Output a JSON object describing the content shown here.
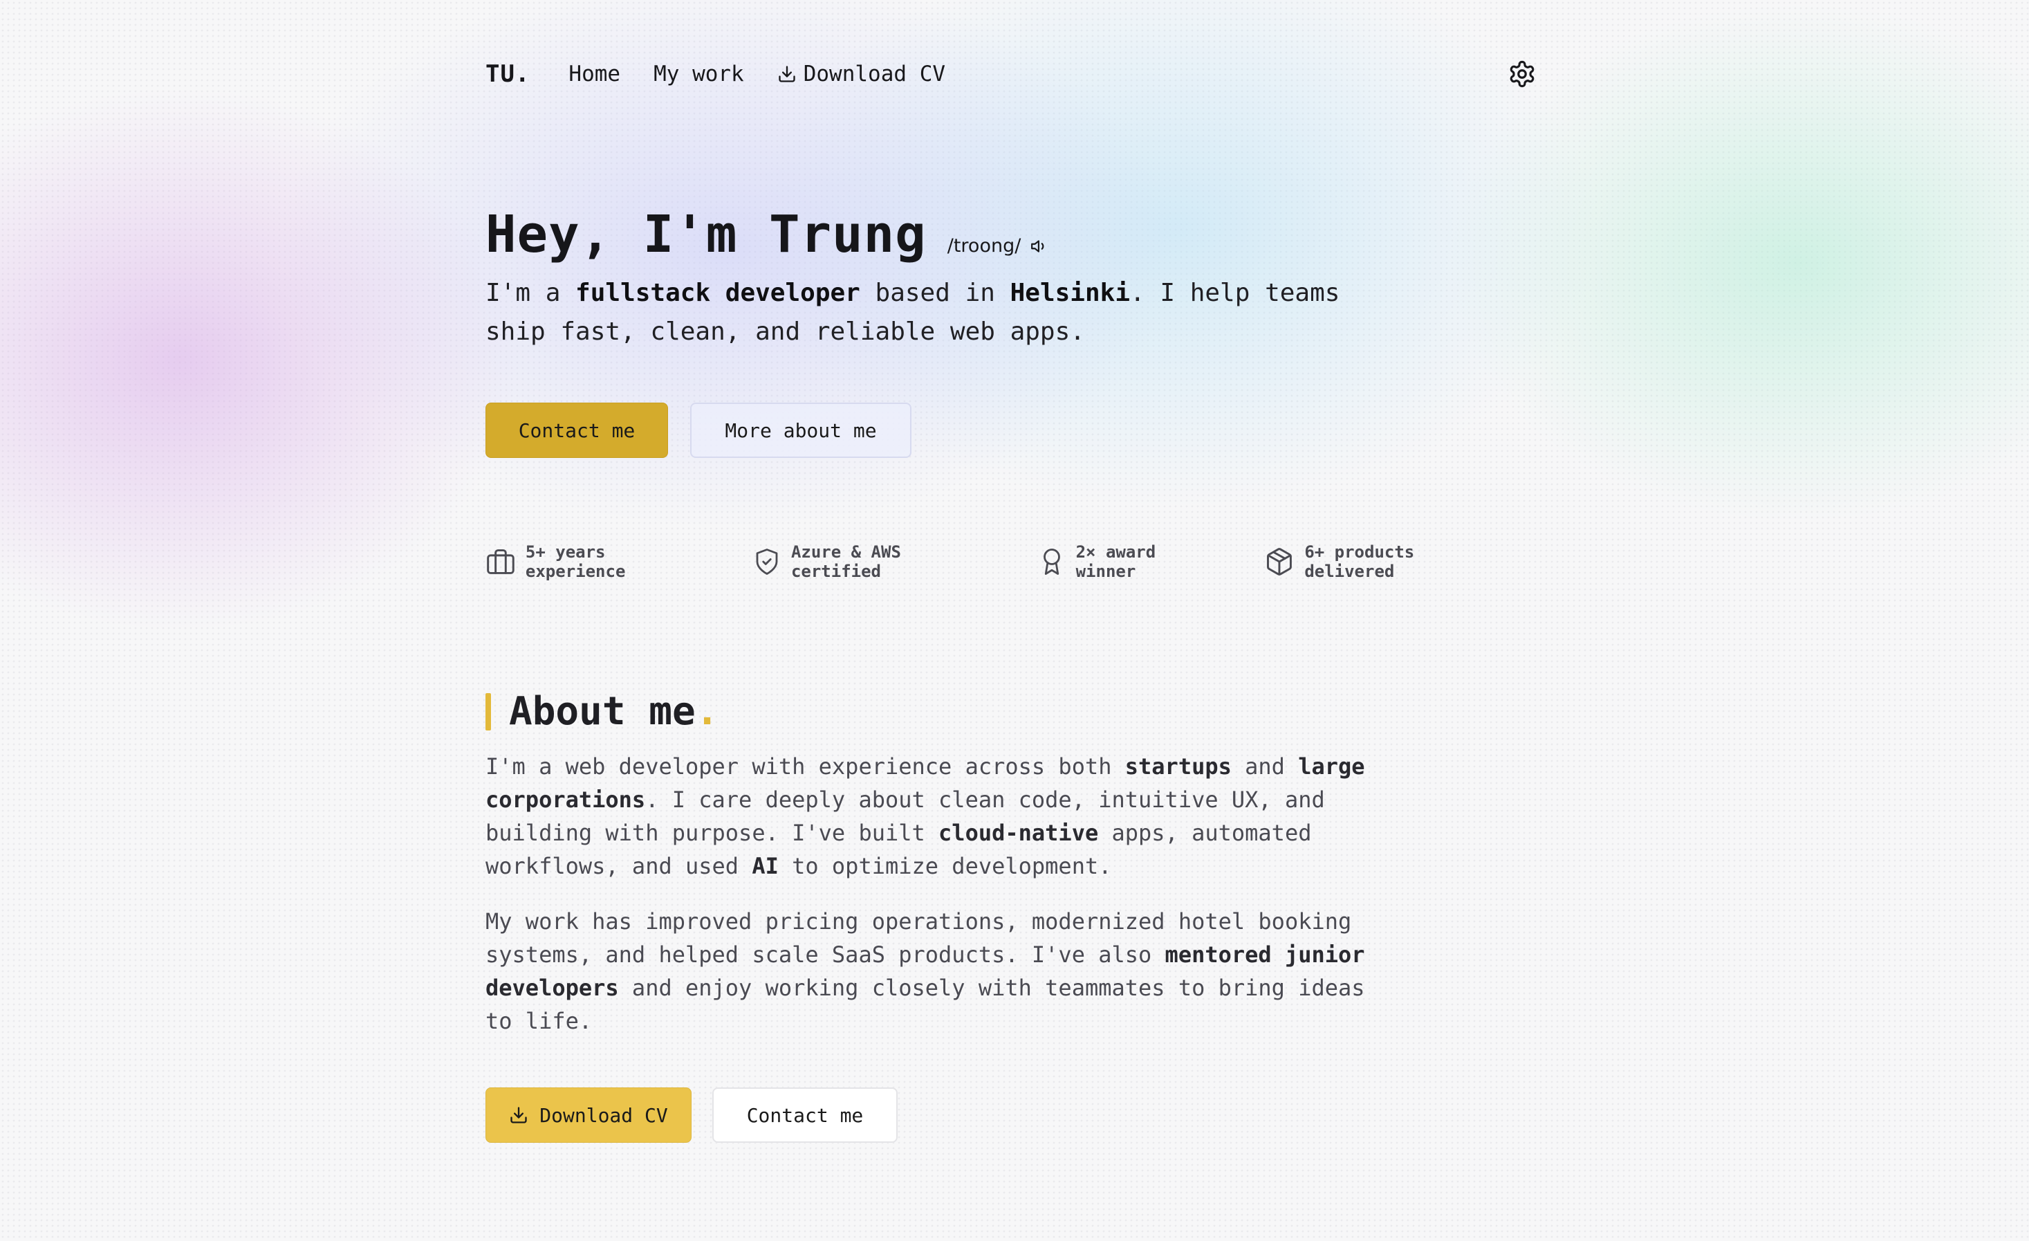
{
  "nav": {
    "logo": "TU.",
    "links": [
      "Home",
      "My work",
      "Download CV"
    ],
    "settings_icon": "gear-icon"
  },
  "hero": {
    "heading": "Hey, I'm Trung",
    "pronunciation": "/troong/",
    "intro": {
      "p1": "I'm a ",
      "b1": "fullstack developer",
      "p2": " based in ",
      "b2": "Helsinki",
      "p3": ". I help teams ship fast, clean, and reliable web apps."
    },
    "contact_button": "Contact me",
    "more_button": "More about me"
  },
  "stats": [
    {
      "icon": "briefcase-icon",
      "label": "5+ years experience"
    },
    {
      "icon": "shield-check-icon",
      "label": "Azure & AWS certified"
    },
    {
      "icon": "award-icon",
      "label": "2× award winner"
    },
    {
      "icon": "package-icon",
      "label": "6+ products delivered"
    }
  ],
  "about": {
    "heading": "About me",
    "dot": ".",
    "para1": {
      "t1": "I'm a web developer with experience across both ",
      "b1": "startups",
      "t2": " and ",
      "b2": "large corporations",
      "t3": ". I care deeply about clean code, intuitive UX, and building with purpose. I've built ",
      "b3": "cloud-native",
      "t4": " apps, automated workflows, and used ",
      "b4": "AI",
      "t5": " to optimize development."
    },
    "para2": {
      "t1": "My work has improved pricing operations, modernized hotel booking systems, and helped scale SaaS products. I've also ",
      "b1": "mentored junior developers",
      "t2": " and enjoy working closely with teammates to bring ideas to life."
    },
    "download_button": "Download CV",
    "contact_button": "Contact me"
  },
  "colors": {
    "accent": "#d4ab2c",
    "accent_light": "#ebc44b",
    "text": "#16161a"
  }
}
